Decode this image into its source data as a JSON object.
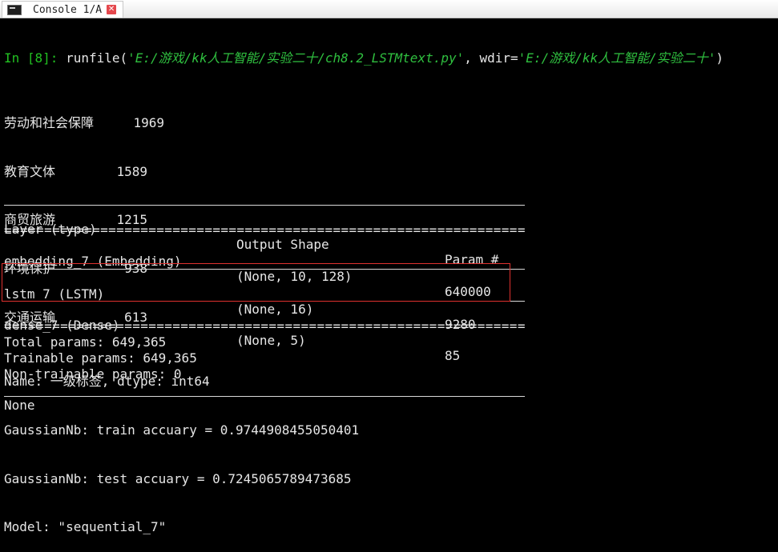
{
  "tab": {
    "label": "Console 1/A",
    "close_glyph": "✕"
  },
  "command": {
    "prompt": "In [8]:",
    "fn": "runfile(",
    "path": "'E:/游戏/kk人工智能/实验二十/ch8.2_LSTMtext.py'",
    "sep": ", wdir=",
    "wdir": "'E:/游戏/kk人工智能/实验二十'",
    "close": ")"
  },
  "counts": [
    {
      "label": "劳动和社会保障",
      "value": "1969"
    },
    {
      "label": "教育文体",
      "value": "1589"
    },
    {
      "label": "商贸旅游",
      "value": "1215"
    },
    {
      "label": "环境保护",
      "value": "938"
    },
    {
      "label": "交通运输",
      "value": "613"
    }
  ],
  "output": {
    "name_line": "Name: 一级标签, dtype: int64",
    "train_line": "GaussianNb: train accuary = 0.9744908455050401",
    "test_line": "GaussianNb: test accuary = 0.7245065789473685",
    "model_line": "Model: \"sequential_7\""
  },
  "summary": {
    "headers": [
      "Layer (type)",
      "Output Shape",
      "Param #"
    ],
    "rule_equals": "=================================================================",
    "rows": [
      {
        "layer": "embedding_7 (Embedding)",
        "shape": "(None, 10, 128)",
        "params": "640000"
      },
      {
        "layer": "lstm_7 (LSTM)",
        "shape": "(None, 16)",
        "params": "9280"
      },
      {
        "layer": "dense_7 (Dense)",
        "shape": "(None, 5)",
        "params": "85"
      }
    ],
    "total": "Total params: 649,365",
    "trainable": "Trainable params: 649,365",
    "non_trainable": "Non-trainable params: 0",
    "none_line": "None"
  },
  "colors": {
    "background": "#000000",
    "prompt": "#22c122",
    "string": "#2fbf3f",
    "highlight_box": "#e0312f"
  }
}
